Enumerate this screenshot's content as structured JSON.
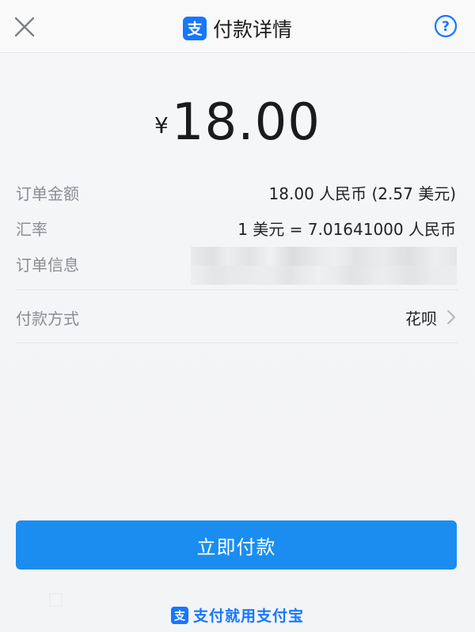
{
  "header": {
    "title": "付款详情"
  },
  "amount": {
    "currency_symbol": "¥",
    "value": "18.00"
  },
  "details": {
    "order_amount_label": "订单金额",
    "order_amount_value": "18.00 人民币 (2.57 美元)",
    "exchange_rate_label": "汇率",
    "exchange_rate_value": "1 美元 = 7.01641000 人民币",
    "order_info_label": "订单信息"
  },
  "payment_method": {
    "label": "付款方式",
    "value": "花呗"
  },
  "actions": {
    "pay_button_label": "立即付款"
  },
  "footer": {
    "slogan": "支付就用支付宝"
  },
  "colors": {
    "brand_blue": "#1677ff",
    "button_blue": "#1b8df0"
  },
  "icons": [
    "close-icon",
    "alipay-logo-icon",
    "help-icon",
    "chevron-right-icon"
  ]
}
